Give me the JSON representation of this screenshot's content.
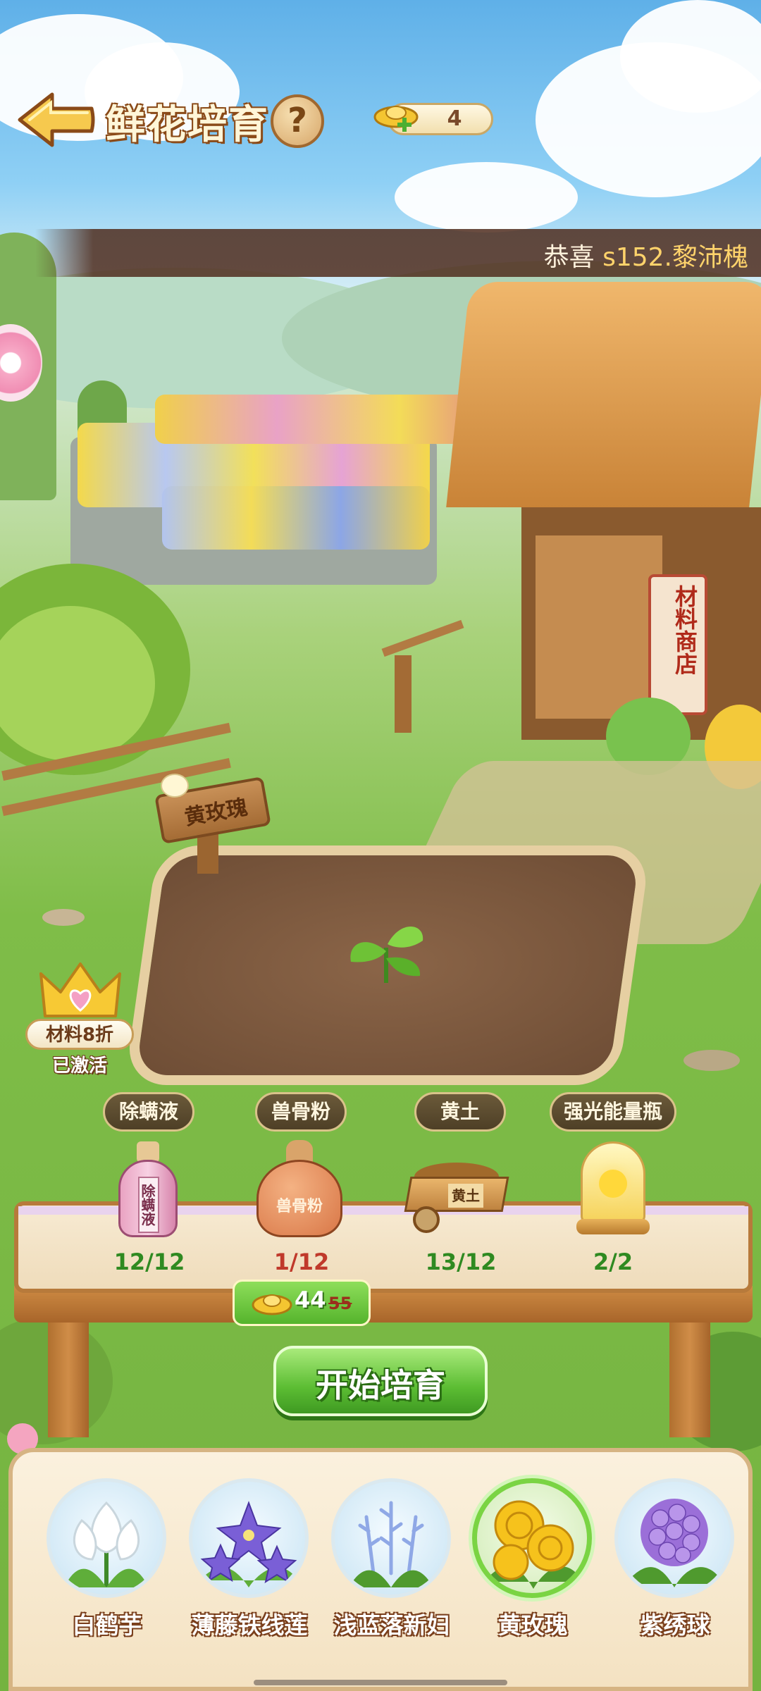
{
  "header": {
    "title": "鲜花培育",
    "help_label": "?",
    "gold_amount": "4"
  },
  "banner": {
    "prefix": "恭喜",
    "player": "s152.黎沛槐"
  },
  "plot": {
    "sign_label": "黄玫瑰",
    "shop_sign": "材料商店"
  },
  "discount": {
    "label": "材料8折",
    "status": "已激活"
  },
  "materials": [
    {
      "name": "除螨液",
      "count": "12/12",
      "icon": "spray-bottle-icon",
      "sufficient": true
    },
    {
      "name": "兽骨粉",
      "count": "1/12",
      "icon": "bone-powder-sack-icon",
      "sufficient": false
    },
    {
      "name": "黄土",
      "count": "13/12",
      "icon": "soil-cart-icon",
      "sufficient": true
    },
    {
      "name": "强光能量瓶",
      "count": "2/2",
      "icon": "sun-jar-icon",
      "sufficient": true
    }
  ],
  "material_icon_text": {
    "spray": "除螨液",
    "sack": "兽骨粉",
    "cart": "黄土"
  },
  "cost": {
    "value": "44",
    "original": "55"
  },
  "start_button": "开始培育",
  "flowers": [
    {
      "name": "白鹤芋",
      "selected": false
    },
    {
      "name": "薄藤铁线莲",
      "selected": false
    },
    {
      "name": "浅蓝落新妇",
      "selected": false
    },
    {
      "name": "黄玫瑰",
      "selected": true
    },
    {
      "name": "紫绣球",
      "selected": false
    }
  ],
  "colors": {
    "accent_green": "#5cbd33",
    "count_ok": "#2f8a21",
    "count_low": "#c0392b",
    "title_outline": "#8a4a18"
  }
}
